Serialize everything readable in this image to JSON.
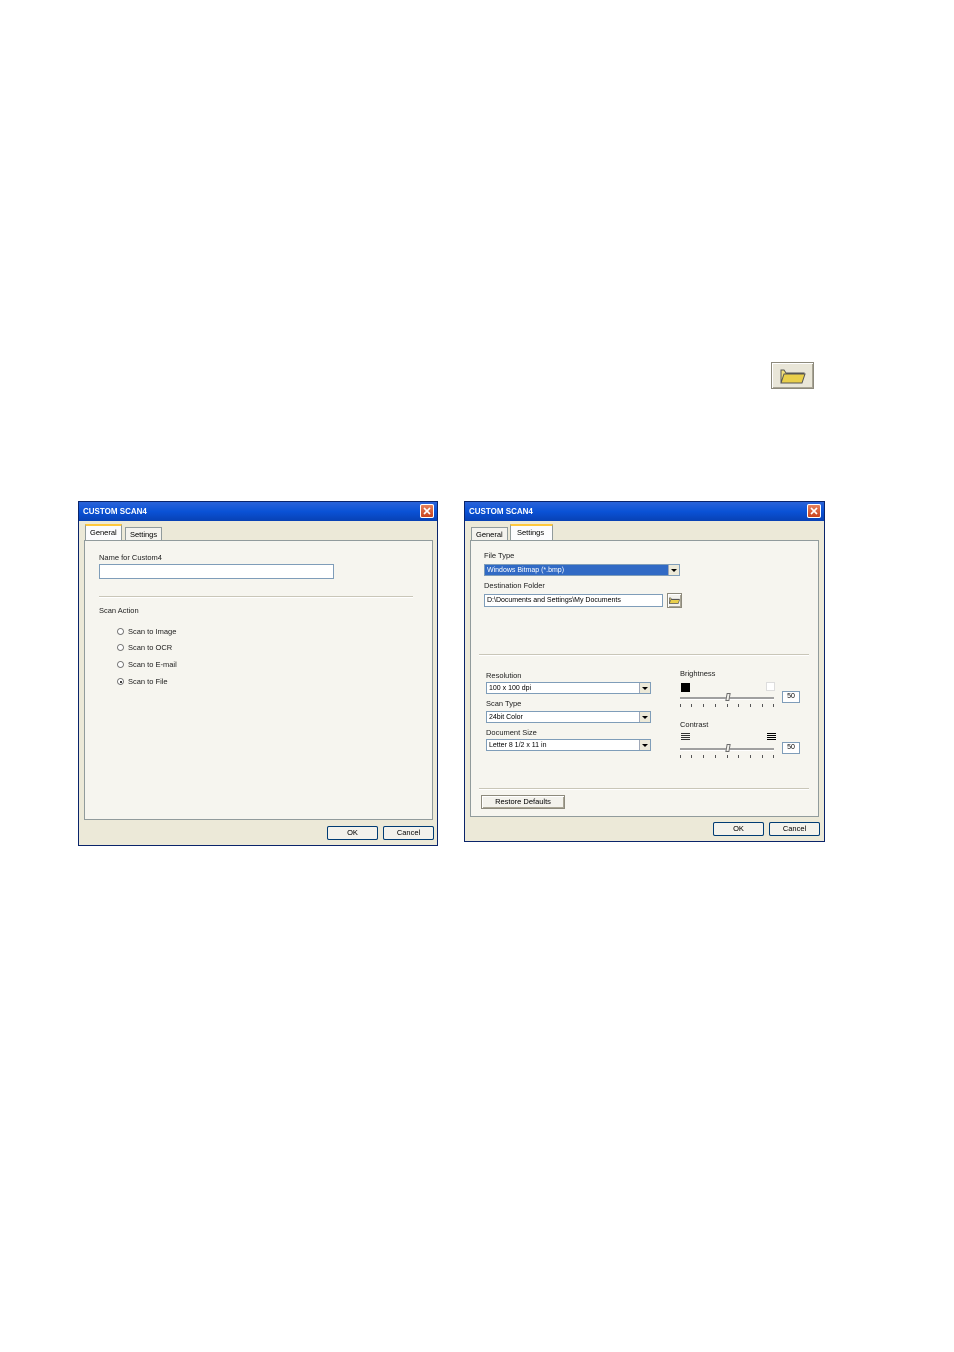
{
  "dialog_left": {
    "title": "CUSTOM SCAN4",
    "tabs": [
      "General",
      "Settings"
    ],
    "name_label": "Name for Custom4",
    "name_value": "",
    "scan_action_label": "Scan Action",
    "options": [
      "Scan to Image",
      "Scan to OCR",
      "Scan to E-mail",
      "Scan to File"
    ],
    "selected_option": "Scan to File",
    "ok": "OK",
    "cancel": "Cancel"
  },
  "dialog_right": {
    "title": "CUSTOM SCAN4",
    "tabs": [
      "General",
      "Settings"
    ],
    "file_type_label": "File Type",
    "file_type_value": "Windows Bitmap (*.bmp)",
    "dest_folder_label": "Destination Folder",
    "dest_folder_value": "D:\\Documents and Settings\\My Documents",
    "resolution_label": "Resolution",
    "resolution_value": "100 x 100 dpi",
    "scan_type_label": "Scan Type",
    "scan_type_value": "24bit Color",
    "doc_size_label": "Document Size",
    "doc_size_value": "Letter 8 1/2 x 11 in",
    "brightness_label": "Brightness",
    "brightness_value": "50",
    "contrast_label": "Contrast",
    "contrast_value": "50",
    "restore_defaults": "Restore Defaults",
    "ok": "OK",
    "cancel": "Cancel"
  },
  "icons": {
    "folder_button": "folder-icon"
  },
  "colors": {
    "titlebar": "#0a52d6",
    "dialog_bg": "#ece9d8",
    "selection": "#316ac5",
    "tab_highlight": "#ffc83c"
  }
}
